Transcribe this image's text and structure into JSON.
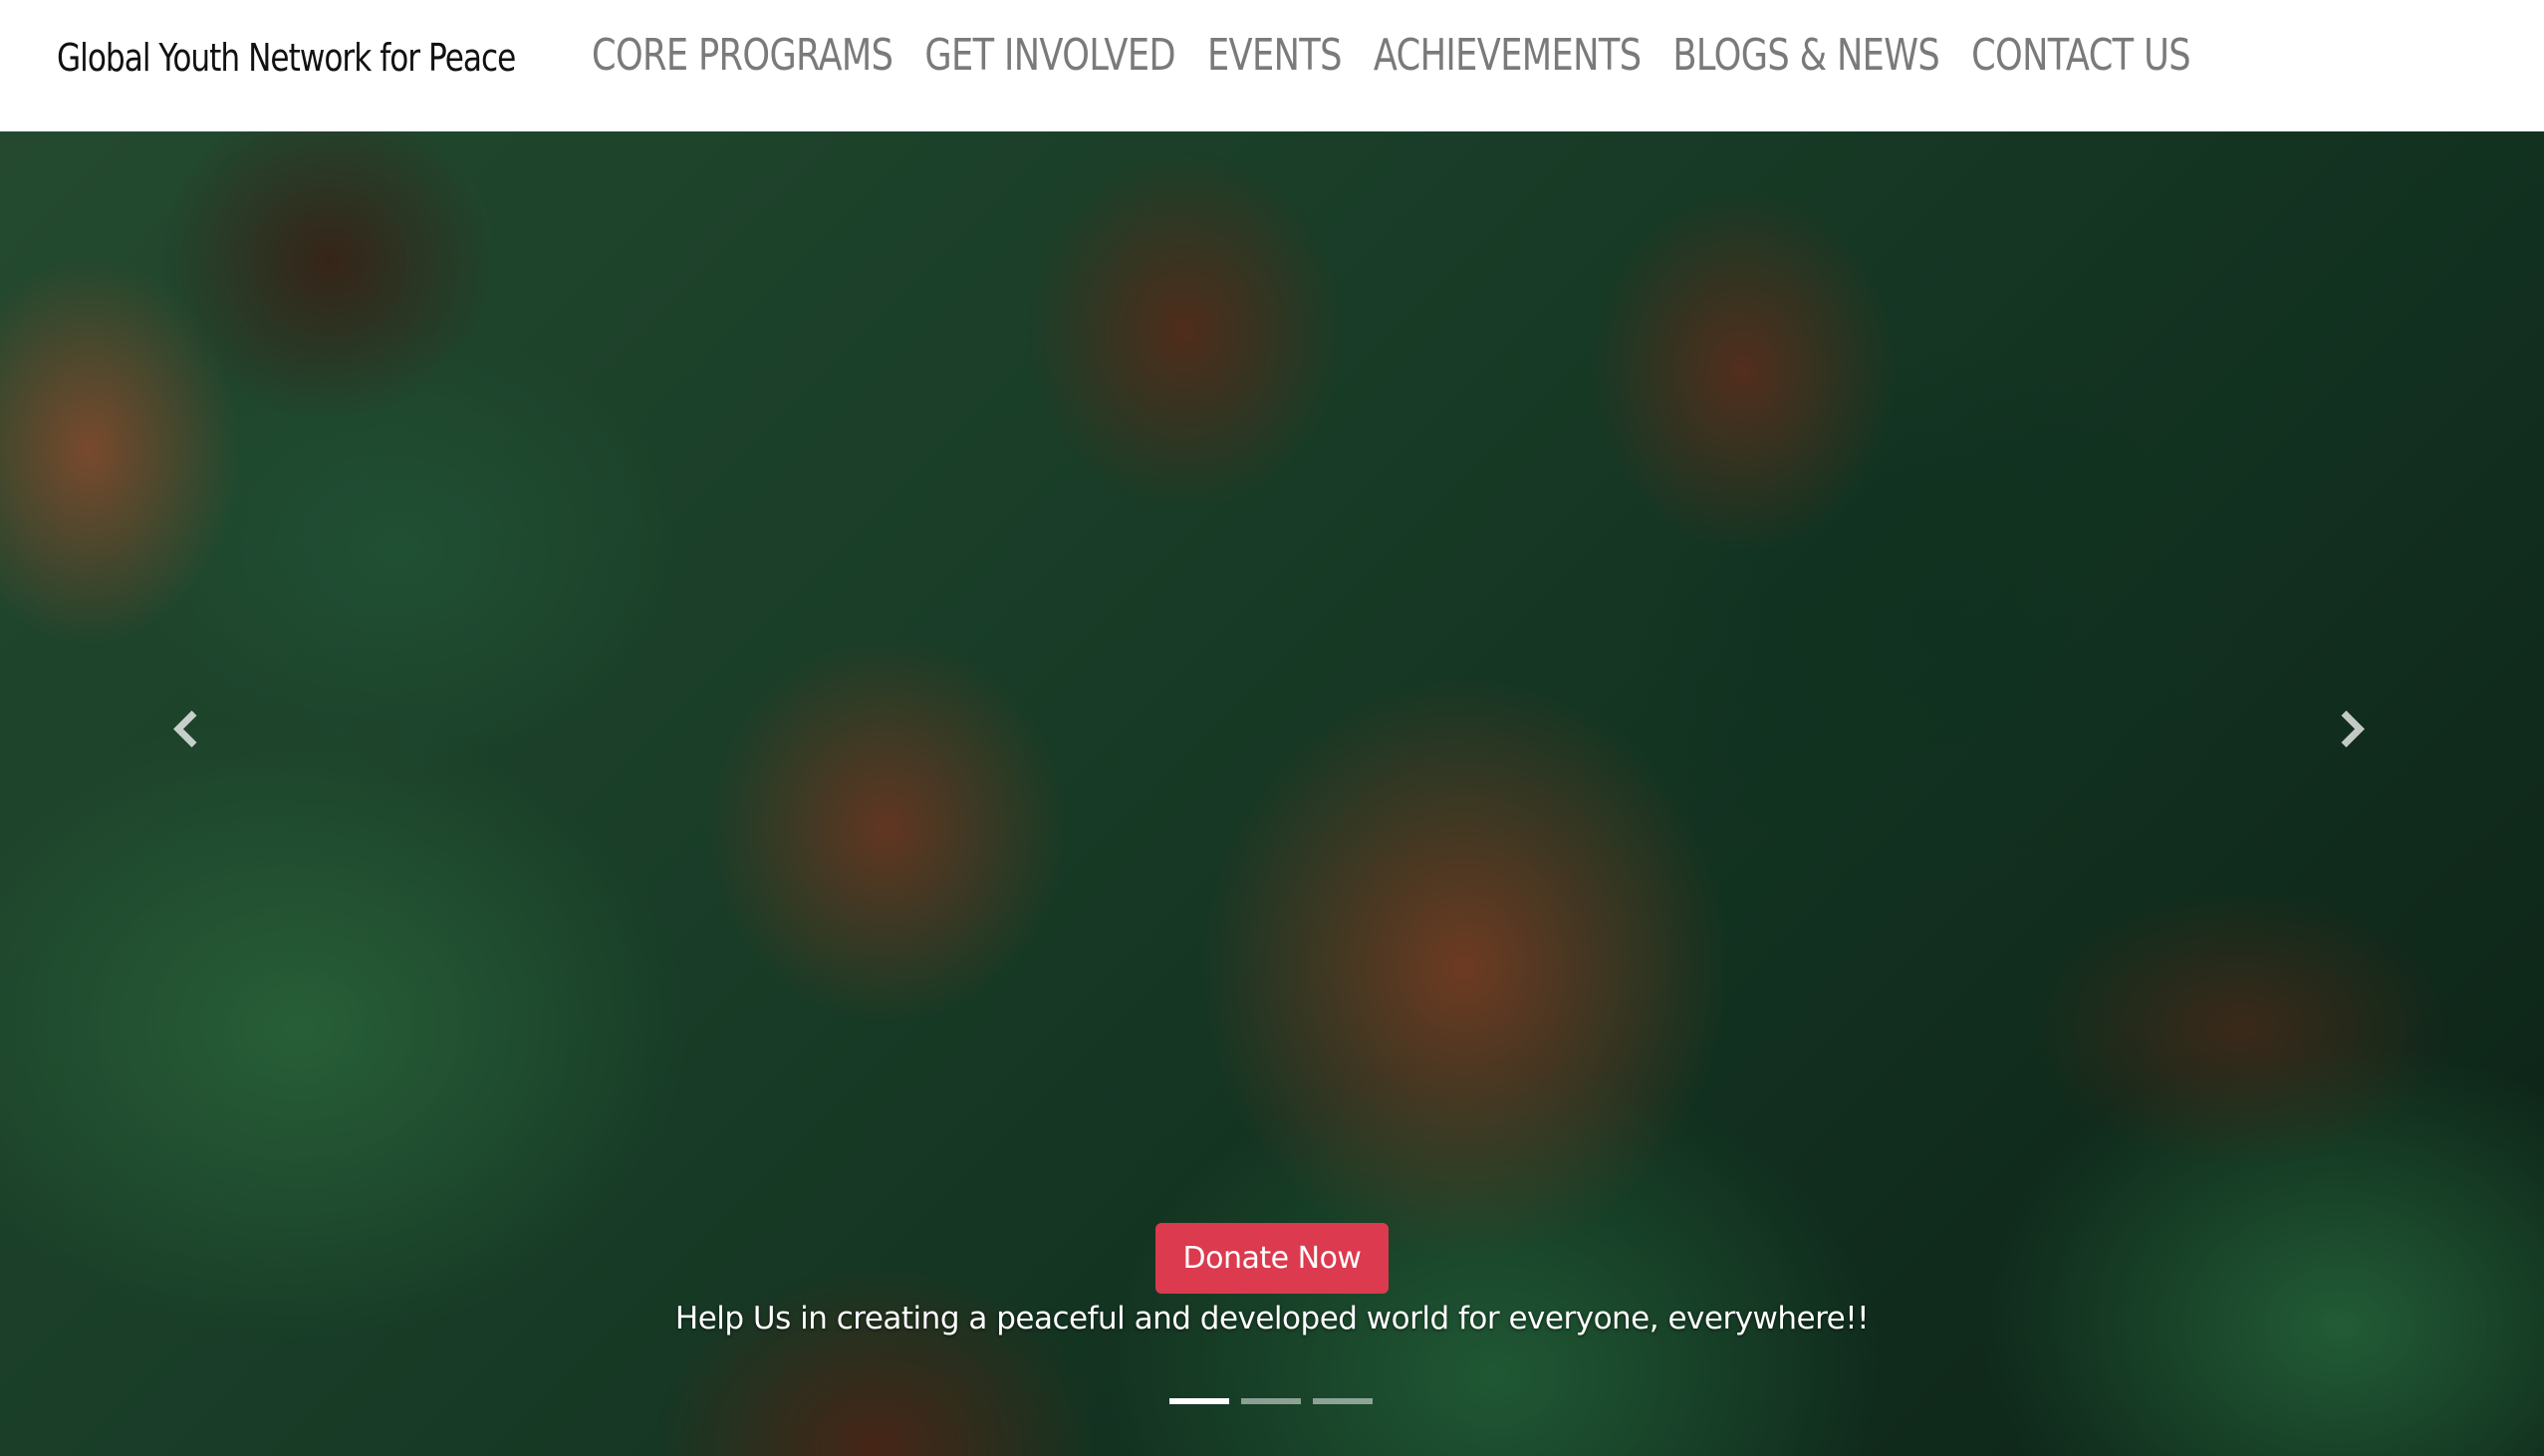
{
  "header": {
    "brand": "Global Youth Network for Peace",
    "nav": [
      {
        "label": "CORE PROGRAMS"
      },
      {
        "label": "GET INVOLVED"
      },
      {
        "label": "EVENTS"
      },
      {
        "label": "ACHIEVEMENTS"
      },
      {
        "label": "BLOGS & NEWS"
      },
      {
        "label": "CONTACT US"
      }
    ]
  },
  "hero": {
    "cta_label": "Donate Now",
    "tagline": "Help Us in creating a peaceful and developed world for everyone, everywhere!!",
    "prev_icon": "chevron-left-icon",
    "next_icon": "chevron-right-icon",
    "slides_total": 3,
    "active_slide": 1
  },
  "colors": {
    "cta": "#dc3a4e",
    "nav_text": "#7a7a7a",
    "brand_text": "#111111"
  }
}
